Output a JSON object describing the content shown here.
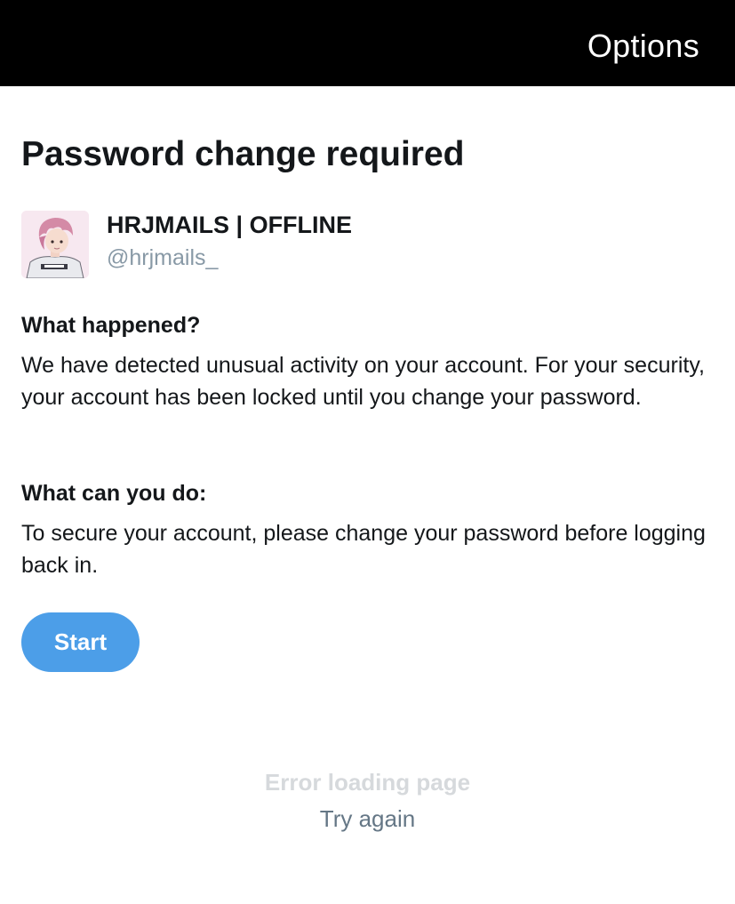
{
  "header": {
    "options_label": "Options"
  },
  "page": {
    "title": "Password change required"
  },
  "account": {
    "display_name": "HRJMAILS | OFFLINE",
    "handle": "@hrjmails_",
    "avatar_icon": "anime-avatar-pink-hair"
  },
  "sections": [
    {
      "heading": "What happened?",
      "body": "We have detected unusual activity on your account. For your security, your account has been locked until you change your password."
    },
    {
      "heading": "What can you do:",
      "body": "To secure your account, please change your password before logging back in."
    }
  ],
  "actions": {
    "start_label": "Start"
  },
  "footer": {
    "error_text": "Error loading page",
    "retry_label": "Try again"
  },
  "colors": {
    "topbar": "#000000",
    "button": "#4c9ee8",
    "text": "#14171a",
    "secondary": "#8899a6"
  }
}
